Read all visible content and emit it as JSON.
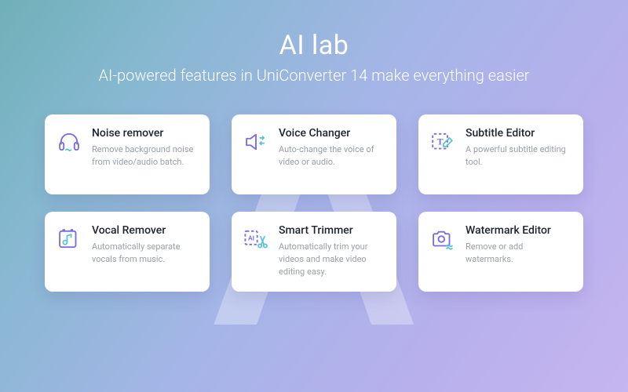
{
  "header": {
    "title": "AI lab",
    "subtitle": "AI-powered features in UniConverter 14 make everything easier"
  },
  "features": [
    {
      "id": "noise-remover",
      "icon": "headphones-wave-icon",
      "title": "Noise remover",
      "desc": "Remove background noise from video/audio batch."
    },
    {
      "id": "voice-changer",
      "icon": "speaker-swap-icon",
      "title": "Voice Changer",
      "desc": "Auto-change the voice of video or audio."
    },
    {
      "id": "subtitle-editor",
      "icon": "text-frame-icon",
      "title": "Subtitle Editor",
      "desc": "A powerful subtitle editing tool."
    },
    {
      "id": "vocal-remover",
      "icon": "music-note-icon",
      "title": "Vocal Remover",
      "desc": "Automatically separate vocals from music."
    },
    {
      "id": "smart-trimmer",
      "icon": "ai-scissors-icon",
      "title": "Smart Trimmer",
      "desc": "Automatically trim your videos and make video editing easy."
    },
    {
      "id": "watermark-editor",
      "icon": "camera-wave-icon",
      "title": "Watermark Editor",
      "desc": "Remove or add watermarks."
    }
  ]
}
